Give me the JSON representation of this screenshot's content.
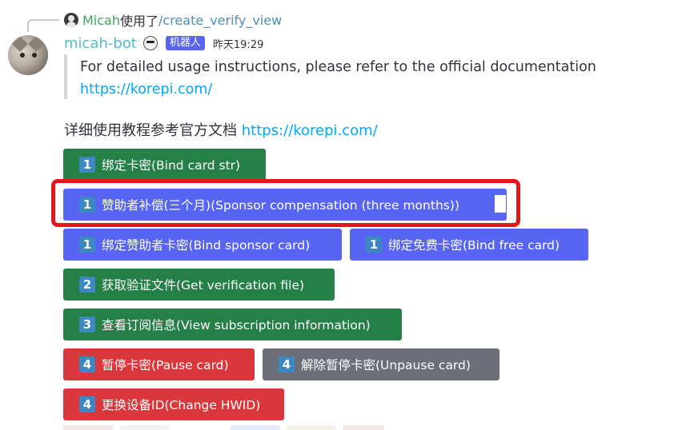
{
  "reply": {
    "user": "Micah",
    "verb": "使用了",
    "command": "/create_verify_view"
  },
  "message": {
    "author": "micah-bot",
    "badge": "机器人",
    "timestamp": "昨天19:29",
    "quote_text": "For detailed usage instructions, please refer to the official documentation",
    "quote_link": "https://korepi.com/",
    "detail_text": "详细使用教程参考官方文档 ",
    "detail_link": "https://korepi.com/"
  },
  "buttons": [
    {
      "num": "1",
      "label": "绑定卡密(Bind card str)",
      "color": "#248046"
    },
    {
      "num": "1",
      "label": "赞助者补偿(三个月)(Sponsor compensation (three months))",
      "color": "#5865f2"
    },
    {
      "num": "1",
      "label": "绑定赞助者卡密(Bind sponsor card)",
      "color": "#5865f2"
    },
    {
      "num": "1",
      "label": "绑定免费卡密(Bind free card)",
      "color": "#5865f2"
    },
    {
      "num": "2",
      "label": "获取验证文件(Get verification file)",
      "color": "#248046"
    },
    {
      "num": "3",
      "label": "查看订阅信息(View subscription information)",
      "color": "#248046"
    },
    {
      "num": "4",
      "label": "暂停卡密(Pause card)",
      "color": "#da373c"
    },
    {
      "num": "4",
      "label": "解除暂停卡密(Unpause card)",
      "color": "#6d6f78"
    },
    {
      "num": "4",
      "label": "更换设备ID(Change HWID)",
      "color": "#da373c"
    }
  ],
  "highlight_color": "#e3161c"
}
